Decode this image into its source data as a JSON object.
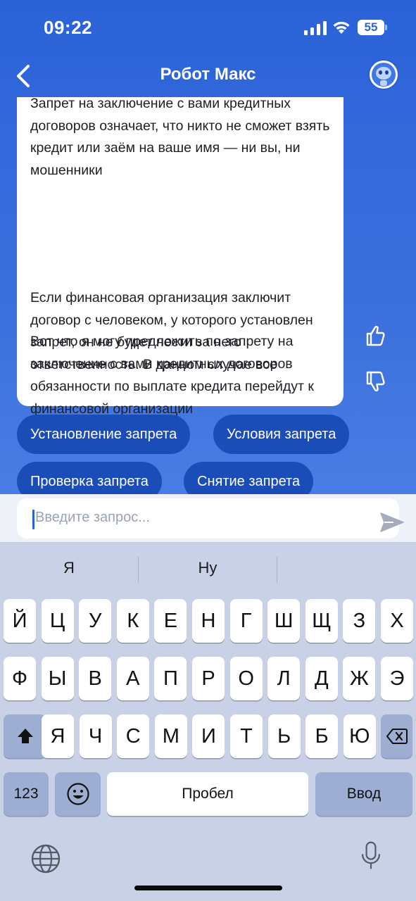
{
  "status_bar": {
    "time": "09:22",
    "battery": "55"
  },
  "header": {
    "title": "Робот Макс"
  },
  "message": {
    "paragraphs": [
      "Запрет на заключение с вами кредитных договоров означает, что никто не сможет взять кредит или заём на ваше имя — ни вы, ни мошенники",
      "Если финансовая организация заключит договор с человеком, у которого установлен запрет, он не будет нести за него ответственность. В данном случае все обязанности по выплате кредита перейдут к финансовой организации",
      "Вот что я могу предложить по запрету на заключение с вами кредитных договоров"
    ]
  },
  "quick_replies": [
    "Установление запрета",
    "Условия запрета",
    "Проверка запрета",
    "Снятие запрета"
  ],
  "input": {
    "placeholder": "Введите запрос..."
  },
  "keyboard": {
    "suggestions": [
      "Я",
      "Ну"
    ],
    "row1": [
      "Й",
      "Ц",
      "У",
      "К",
      "Е",
      "Н",
      "Г",
      "Ш",
      "Щ",
      "З",
      "Х"
    ],
    "row2": [
      "Ф",
      "Ы",
      "В",
      "А",
      "П",
      "Р",
      "О",
      "Л",
      "Д",
      "Ж",
      "Э"
    ],
    "row3": [
      "Я",
      "Ч",
      "С",
      "М",
      "И",
      "Т",
      "Ь",
      "Б",
      "Ю"
    ],
    "numbers_label": "123",
    "space_label": "Пробел",
    "return_label": "Ввод"
  },
  "colors": {
    "accent": "#2b62d8",
    "chip": "#1b4db8",
    "keyboard_bg": "#c8d1e6"
  }
}
